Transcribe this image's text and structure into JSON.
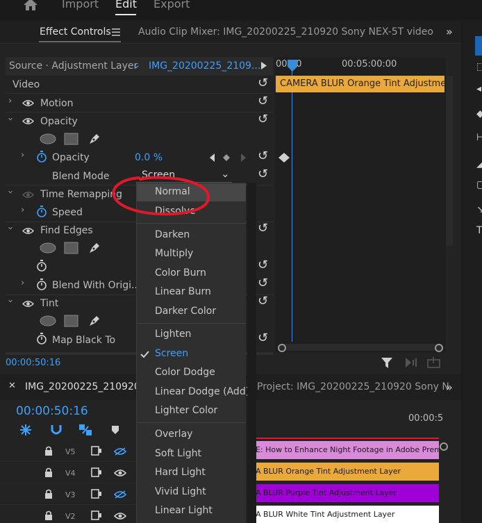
{
  "top_nav": {
    "import": "Import",
    "edit": "Edit",
    "export": "Export"
  },
  "panel_tabs": {
    "effect_controls": "Effect Controls",
    "audio_mixer": "Audio Clip Mixer: IMG_20200225_210920 Sony NEX-5T video"
  },
  "source_bar": {
    "source": "Source · Adjustment Layer",
    "clip": "IMG_20200225_2109..."
  },
  "timeline_mini": {
    "time_start": "00:00",
    "time_mid": "00:05:00:00",
    "clip_label": "CAMERA BLUR Orange Tint Adjustmen"
  },
  "effects": {
    "video_label": "Video",
    "motion": "Motion",
    "opacity_group": "Opacity",
    "opacity_param": "Opacity",
    "opacity_value": "0.0 %",
    "blend_mode_label": "Blend Mode",
    "blend_mode_value": "Screen",
    "time_remapping": "Time Remapping",
    "speed": "Speed",
    "find_edges": "Find Edges",
    "blend_with_original": "Blend With Origi...",
    "tint": "Tint",
    "map_black_to": "Map Black To"
  },
  "current_time_small": "00:00:50:16",
  "blend_menu": {
    "groups": [
      [
        "Normal",
        "Dissolve"
      ],
      [
        "Darken",
        "Multiply",
        "Color Burn",
        "Linear Burn",
        "Darker Color"
      ],
      [
        "Lighten",
        "Screen",
        "Color Dodge",
        "Linear Dodge (Add)",
        "Lighter Color"
      ],
      [
        "Overlay",
        "Soft Light",
        "Hard Light",
        "Vivid Light",
        "Linear Light"
      ]
    ],
    "selected": "Screen",
    "hovered": "Normal"
  },
  "bottom": {
    "sequence_tab": "IMG_20200225_210920 S",
    "project_tab": "Project: IMG_20200225_210920 Sony N",
    "timecode": "00:00:50:16",
    "ruler_label": "00:00:5",
    "tracks": [
      "V5",
      "V4",
      "V3",
      "V2"
    ],
    "clips": [
      "E: How to Enhance Night Footage in Adobe Premier",
      "A BLUR Orange Tint Adjustment Layer",
      "A BLUR Purple Tint Adjustment Layer",
      "A BLUR White Tint Adjustment Layer"
    ]
  },
  "colors": {
    "accent_blue": "#3ea0ff",
    "clip_orange": "#eba93c",
    "clip_pink": "#d98ad9",
    "clip_purple": "#a000d8",
    "clip_white": "#ffffff",
    "annotation_red": "#e0192a"
  }
}
